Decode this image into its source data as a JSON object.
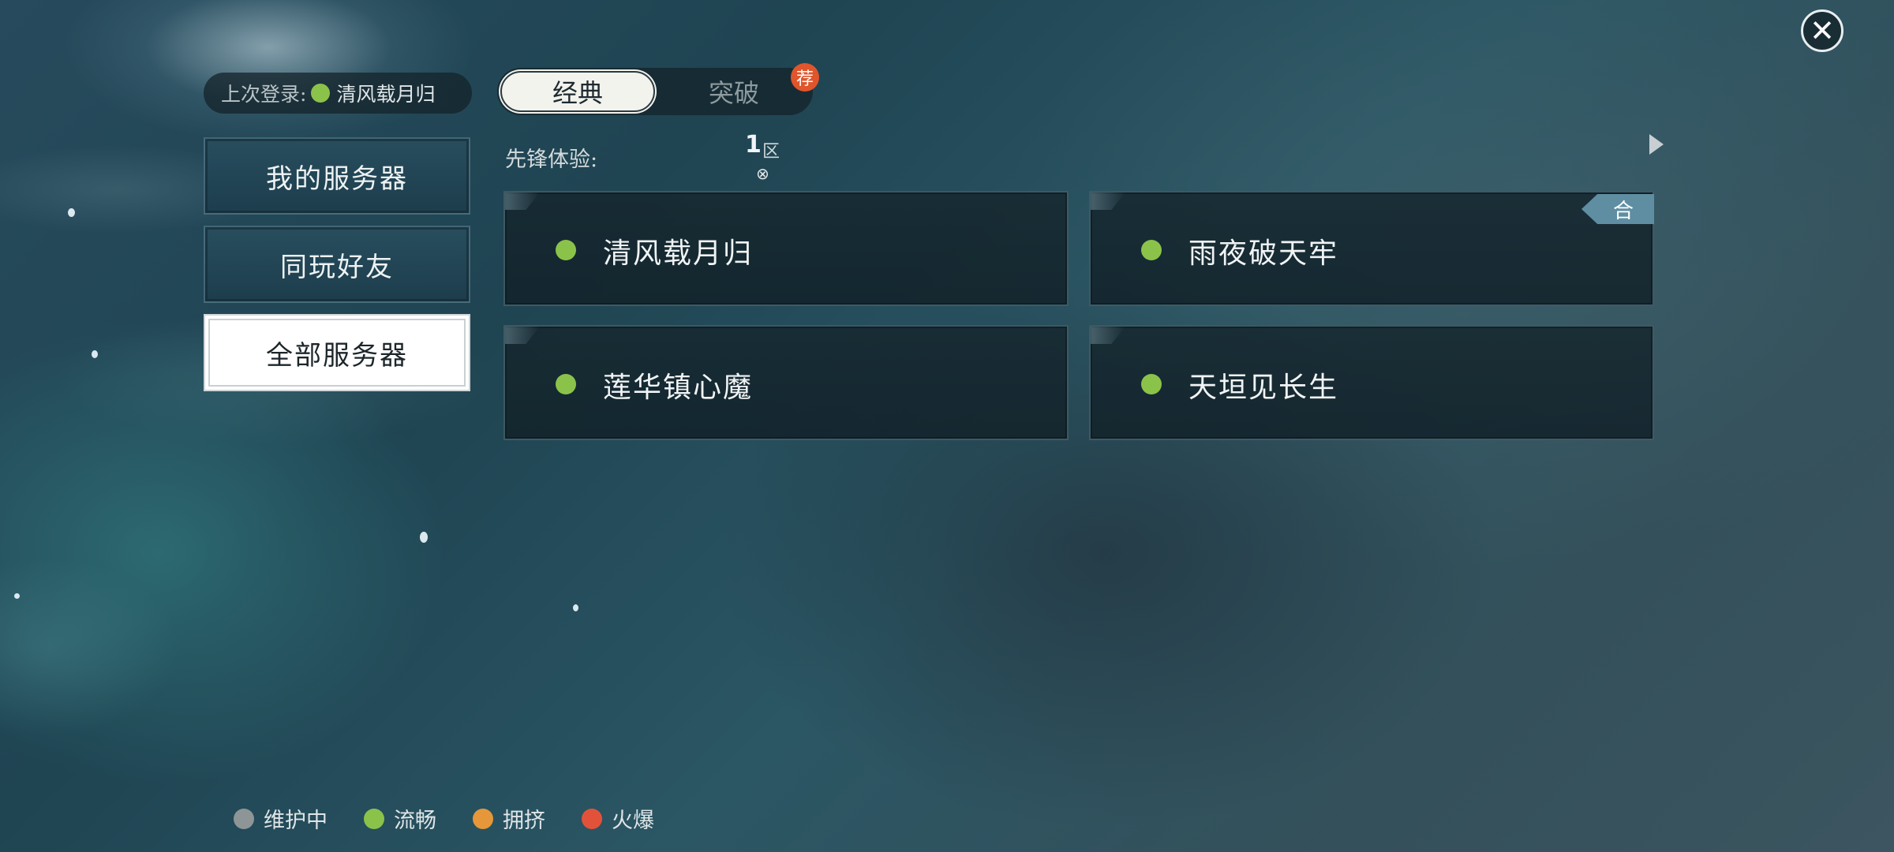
{
  "header": {
    "close_icon": "close-icon",
    "last_login": {
      "label": "上次登录:",
      "server": "清风载月归",
      "status_color": "#8bc34a"
    },
    "mode_tabs": [
      {
        "label": "经典",
        "selected": true
      },
      {
        "label": "突破",
        "selected": false
      }
    ],
    "recommend_badge": "荐"
  },
  "sidebar": {
    "items": [
      {
        "label": "我的服务器",
        "selected": false
      },
      {
        "label": "同玩好友",
        "selected": false
      },
      {
        "label": "全部服务器",
        "selected": true
      }
    ]
  },
  "group": {
    "label": "先锋体验:",
    "zone_number": "1",
    "zone_suffix": "区",
    "zone_mark": "⊗",
    "next_icon": "triangle-right-icon"
  },
  "servers": [
    {
      "name": "清风载月归",
      "status": "流畅",
      "status_color": "#8bc34a",
      "badge": ""
    },
    {
      "name": "雨夜破天牢",
      "status": "流畅",
      "status_color": "#8bc34a",
      "badge": "合"
    },
    {
      "name": "莲华镇心魔",
      "status": "流畅",
      "status_color": "#8bc34a",
      "badge": ""
    },
    {
      "name": "天垣见长生",
      "status": "流畅",
      "status_color": "#8bc34a",
      "badge": ""
    }
  ],
  "legend": [
    {
      "label": "维护中",
      "color": "#8e9597"
    },
    {
      "label": "流畅",
      "color": "#8bc34a"
    },
    {
      "label": "拥挤",
      "color": "#e5973a"
    },
    {
      "label": "火爆",
      "color": "#e2523a"
    }
  ]
}
